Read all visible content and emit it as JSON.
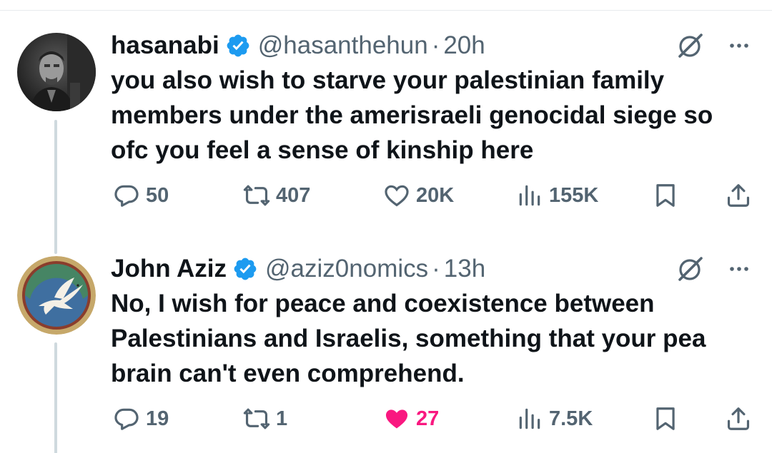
{
  "tweets": [
    {
      "name": "hasanabi",
      "handle": "@hasanthehun",
      "separator": "·",
      "time": "20h",
      "text": "you also wish to starve your palestinian family members under the amerisraeli genocidal siege so ofc you feel a sense of kinship here",
      "replies": "50",
      "reposts": "407",
      "likes": "20K",
      "views": "155K",
      "liked": false
    },
    {
      "name": "John Aziz",
      "handle": "@aziz0nomics",
      "separator": "·",
      "time": "13h",
      "text": "No, I wish for peace and coexistence between Palestinians and Israelis, something that your pea brain can't even comprehend.",
      "replies": "19",
      "reposts": "1",
      "likes": "27",
      "views": "7.5K",
      "liked": true
    }
  ],
  "colors": {
    "verified": "#1d9bf0",
    "muted": "#536471",
    "like_active": "#f91880",
    "thread_line": "#cfd9de"
  },
  "icons": [
    "verified-badge-icon",
    "grok-icon",
    "more-icon",
    "reply-icon",
    "repost-icon",
    "like-icon",
    "views-icon",
    "bookmark-icon",
    "share-icon"
  ]
}
